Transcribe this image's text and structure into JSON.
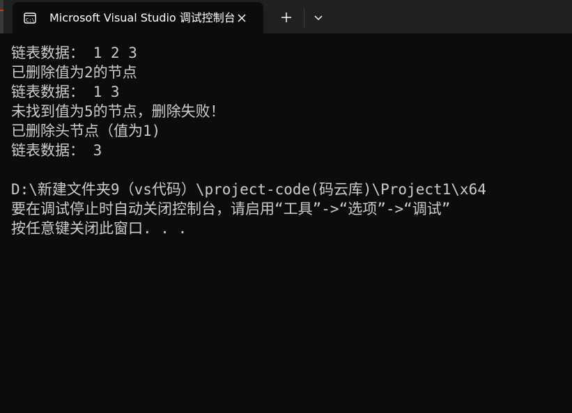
{
  "window": {
    "tab_title": "Microsoft Visual Studio 调试控制台",
    "tab_icon": "console-app-icon"
  },
  "colors": {
    "background": "#0c0c0c",
    "tabbar": "#202020",
    "text": "#cccccc",
    "title_text": "#ffffff"
  },
  "console": {
    "lines": [
      "链表数据： 1 2 3",
      "已删除值为2的节点",
      "链表数据： 1 3",
      "未找到值为5的节点，删除失败！",
      "已删除头节点（值为1)",
      "链表数据： 3",
      "",
      "D:\\新建文件夹9（vs代码）\\project-code(码云库)\\Project1\\x64",
      "要在调试停止时自动关闭控制台，请启用“工具”->“选项”->“调试”",
      "按任意键关闭此窗口. . ."
    ]
  }
}
